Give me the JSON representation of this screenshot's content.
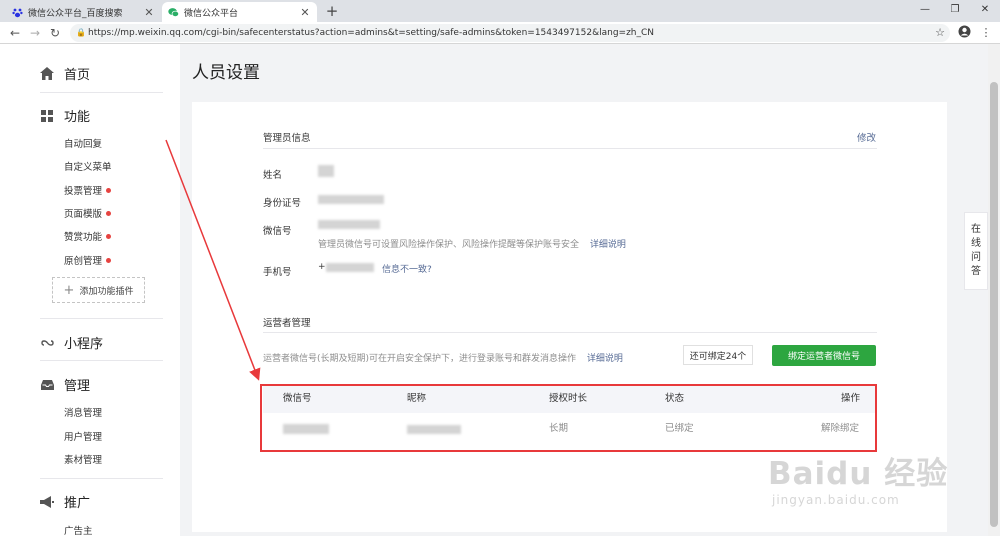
{
  "browser": {
    "tabs": [
      {
        "title": "微信公众平台_百度搜索",
        "active": false,
        "icon": "baidu-paw-icon"
      },
      {
        "title": "微信公众平台",
        "active": true,
        "icon": "wechat-icon"
      }
    ],
    "url": "https://mp.weixin.qq.com/cgi-bin/safecenterstatus?action=admins&t=setting/safe-admins&token=1543497152&lang=zh_CN"
  },
  "sidebar": {
    "home": "首页",
    "function": {
      "title": "功能",
      "items": [
        {
          "label": "自动回复",
          "new": false
        },
        {
          "label": "自定义菜单",
          "new": false
        },
        {
          "label": "投票管理",
          "new": true
        },
        {
          "label": "页面模版",
          "new": true
        },
        {
          "label": "赞赏功能",
          "new": true
        },
        {
          "label": "原创管理",
          "new": true
        }
      ],
      "add_plugin": "添加功能插件"
    },
    "miniprogram": "小程序",
    "manage": {
      "title": "管理",
      "items": [
        "消息管理",
        "用户管理",
        "素材管理"
      ]
    },
    "promote": {
      "title": "推广",
      "items": [
        "广告主"
      ]
    }
  },
  "main": {
    "title": "人员设置",
    "admin": {
      "heading": "管理员信息",
      "edit": "修改",
      "name_label": "姓名",
      "id_label": "身份证号",
      "wechat_label": "微信号",
      "wechat_hint": "管理员微信号可设置风险操作保护、风险操作提醒等保护账号安全",
      "wechat_hint_link": "详细说明",
      "phone_label": "手机号",
      "phone_prefix": "+",
      "phone_link": "信息不一致?"
    },
    "operator": {
      "heading": "运营者管理",
      "hint": "运营者微信号(长期及短期)可在开启安全保护下，进行登录账号和群发消息操作",
      "hint_link": "详细说明",
      "remaining": "还可绑定24个",
      "bind_button": "绑定运营者微信号",
      "table": {
        "headers": [
          "微信号",
          "昵称",
          "授权时长",
          "状态",
          "操作"
        ],
        "rows": [
          {
            "duration": "长期",
            "status": "已绑定",
            "action": "解除绑定"
          }
        ]
      }
    }
  },
  "help": [
    "在",
    "线",
    "问",
    "答"
  ],
  "watermark": {
    "logo": "Baidu 经验",
    "url": "jingyan.baidu.com"
  },
  "colors": {
    "primary_green": "#2da640",
    "link": "#576b95",
    "highlight": "#e8393b",
    "badge": "#e64340"
  }
}
